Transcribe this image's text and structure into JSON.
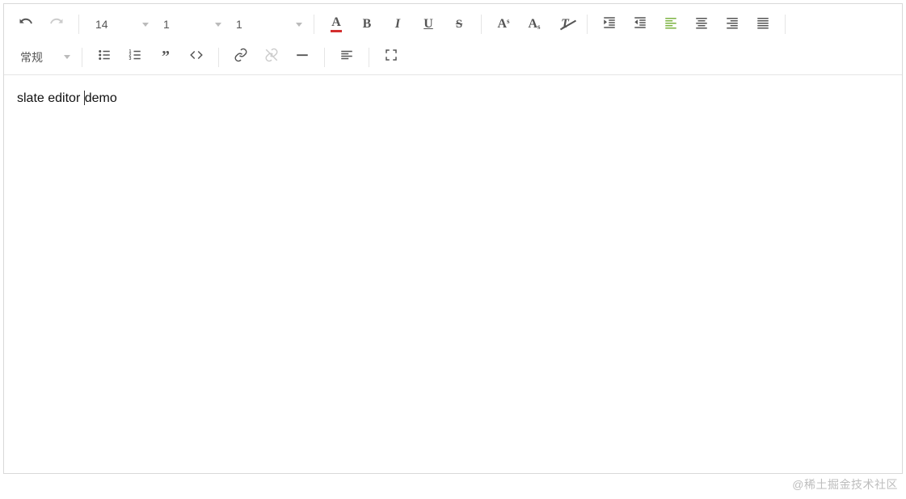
{
  "toolbar": {
    "font_size": "14",
    "line_height": "1",
    "letter_spacing": "1",
    "style_label": "常规"
  },
  "content": {
    "before_cursor": "slate editor ",
    "after_cursor": "demo"
  },
  "watermark": "@稀土掘金技术社区"
}
